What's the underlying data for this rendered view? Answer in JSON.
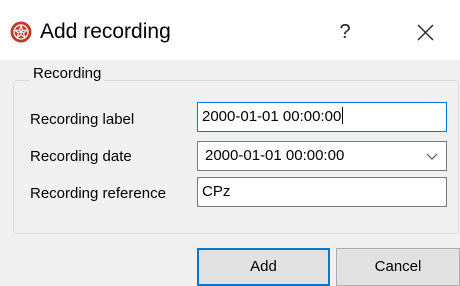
{
  "window": {
    "title": "Add recording",
    "help": "?",
    "icons": {
      "app": "app-logo-icon",
      "close": "close-icon"
    },
    "accent": "#0078d7"
  },
  "group": {
    "title": "Recording",
    "fields": {
      "label": {
        "label": "Recording label",
        "value": "2000-01-01 00:00:00"
      },
      "date": {
        "label": "Recording date",
        "value": "2000-01-01 00:00:00"
      },
      "reference": {
        "label": "Recording reference",
        "value": "CPz"
      }
    }
  },
  "buttons": {
    "add": "Add",
    "cancel": "Cancel"
  }
}
